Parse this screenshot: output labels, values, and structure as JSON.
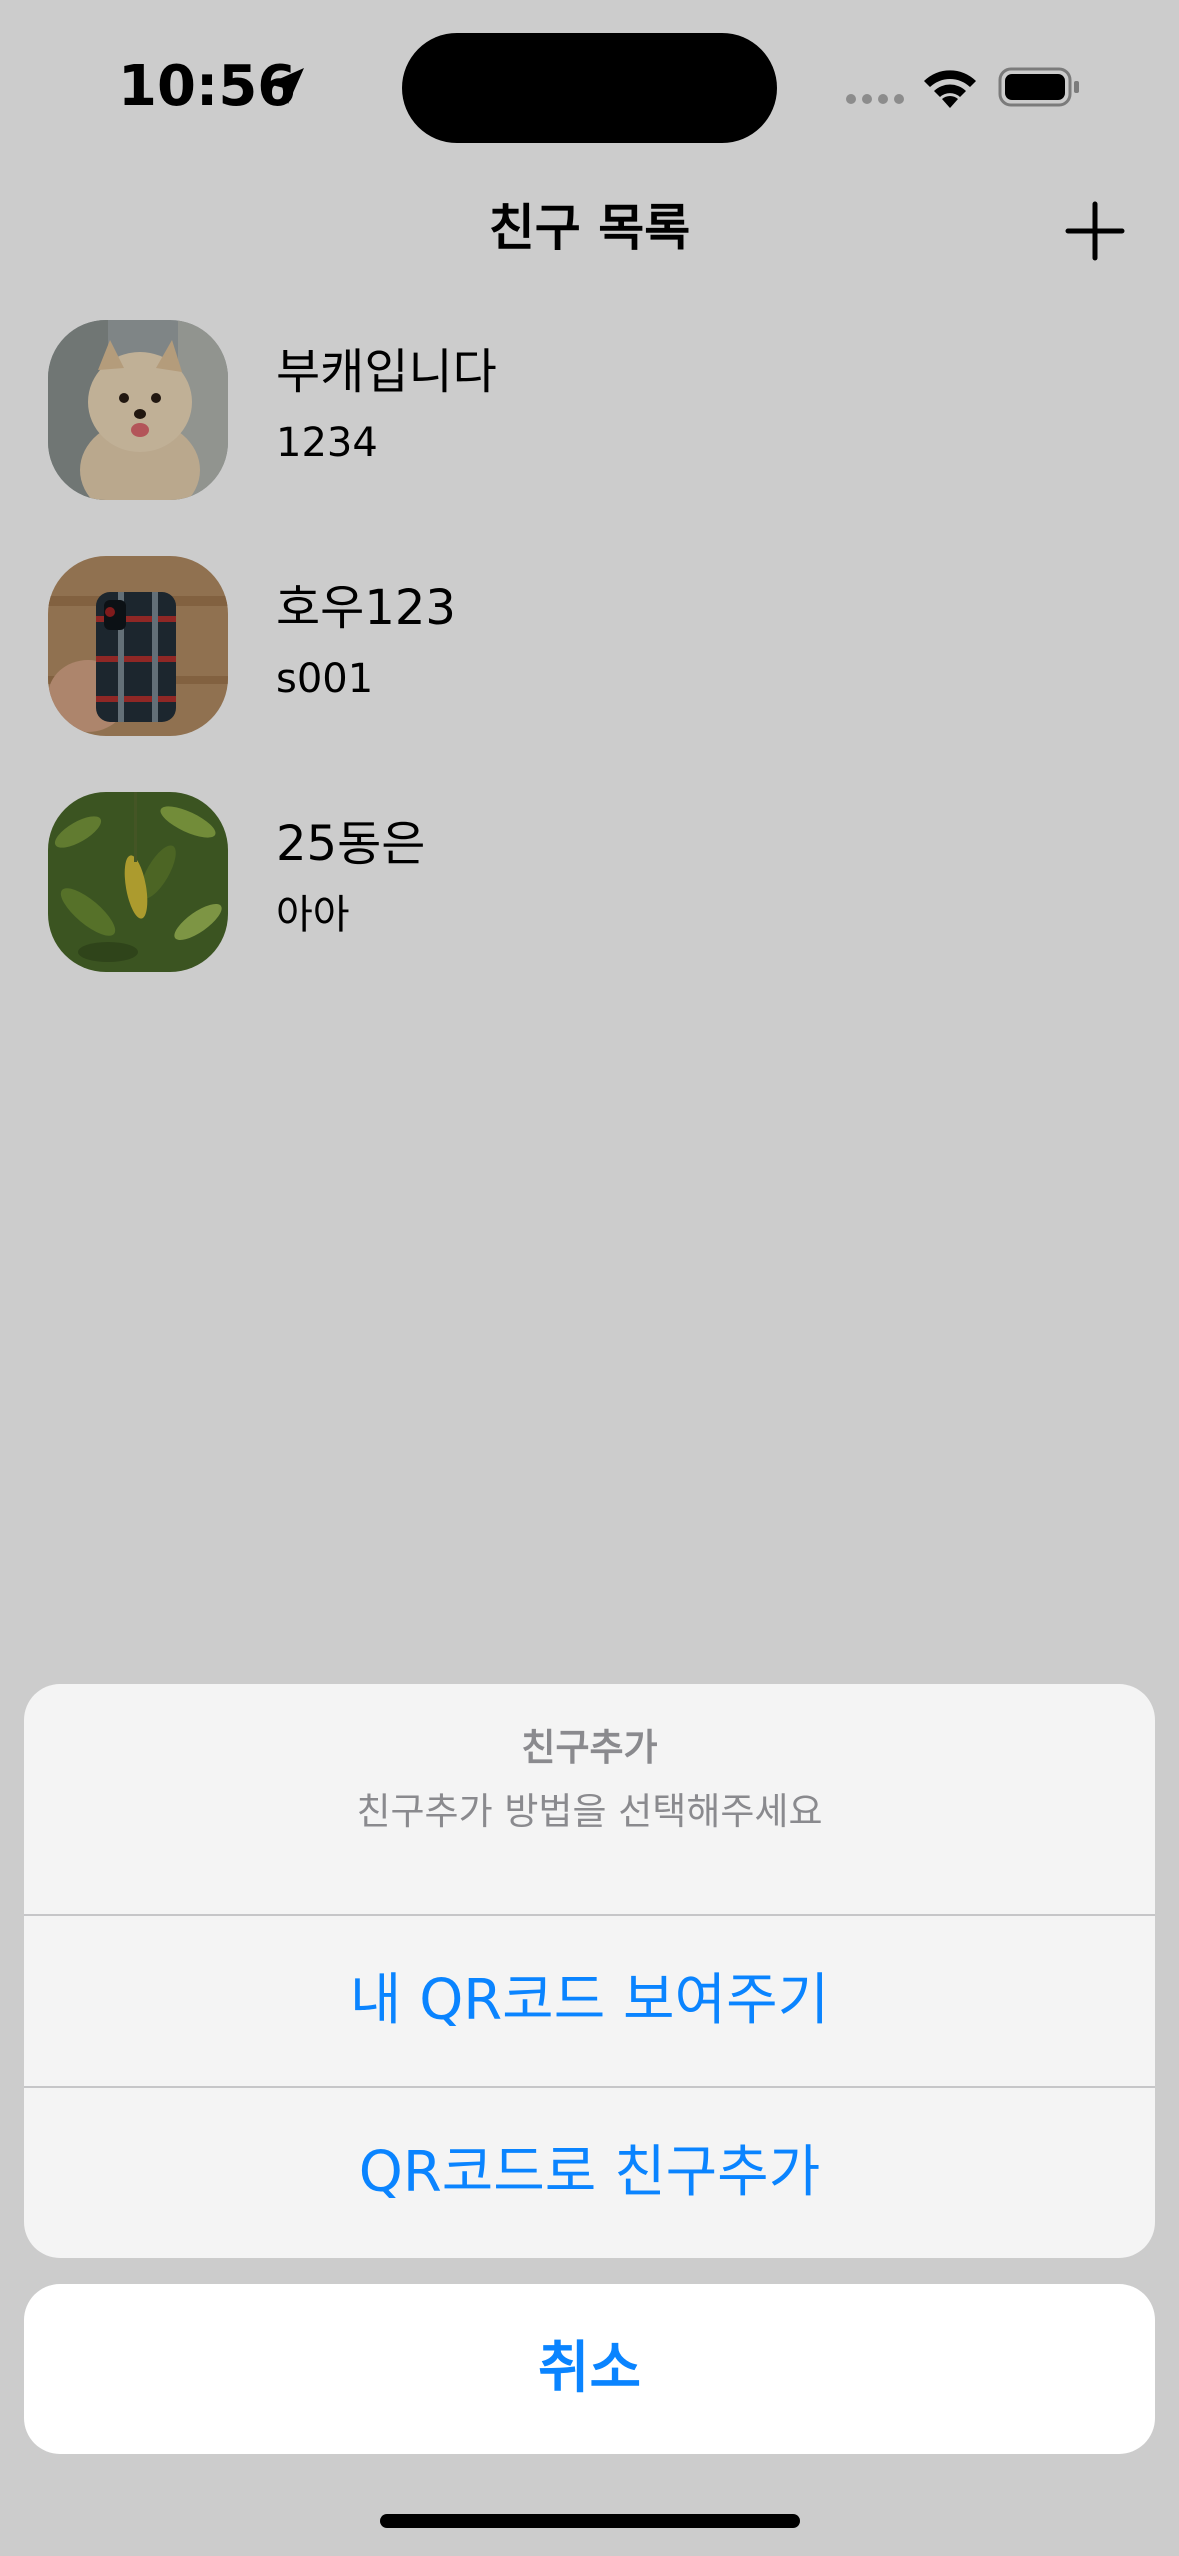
{
  "status_bar": {
    "time": "10:56",
    "location_icon": "location-arrow-icon",
    "signal_icon": "cellular-signal-icon",
    "wifi_icon": "wifi-icon",
    "battery_icon": "battery-full-icon"
  },
  "nav": {
    "title": "친구 목록",
    "add_icon": "plus-icon"
  },
  "friends": [
    {
      "name": "부캐입니다",
      "status": "1234",
      "avatar": "pomeranian-dog-photo"
    },
    {
      "name": "호우123",
      "status": "s001",
      "avatar": "plaid-phone-case-photo"
    },
    {
      "name": "25동은",
      "status": "아아",
      "avatar": "green-leaves-photo"
    }
  ],
  "action_sheet": {
    "title": "친구추가",
    "message": "친구추가 방법을 선택해주세요",
    "actions": [
      {
        "label": "내 QR코드 보여주기"
      },
      {
        "label": "QR코드로 친구추가"
      }
    ],
    "cancel_label": "취소"
  },
  "colors": {
    "accent": "#0a84ff",
    "secondary_text": "#8a8a8e",
    "sheet_background": "#f6f6f6"
  }
}
